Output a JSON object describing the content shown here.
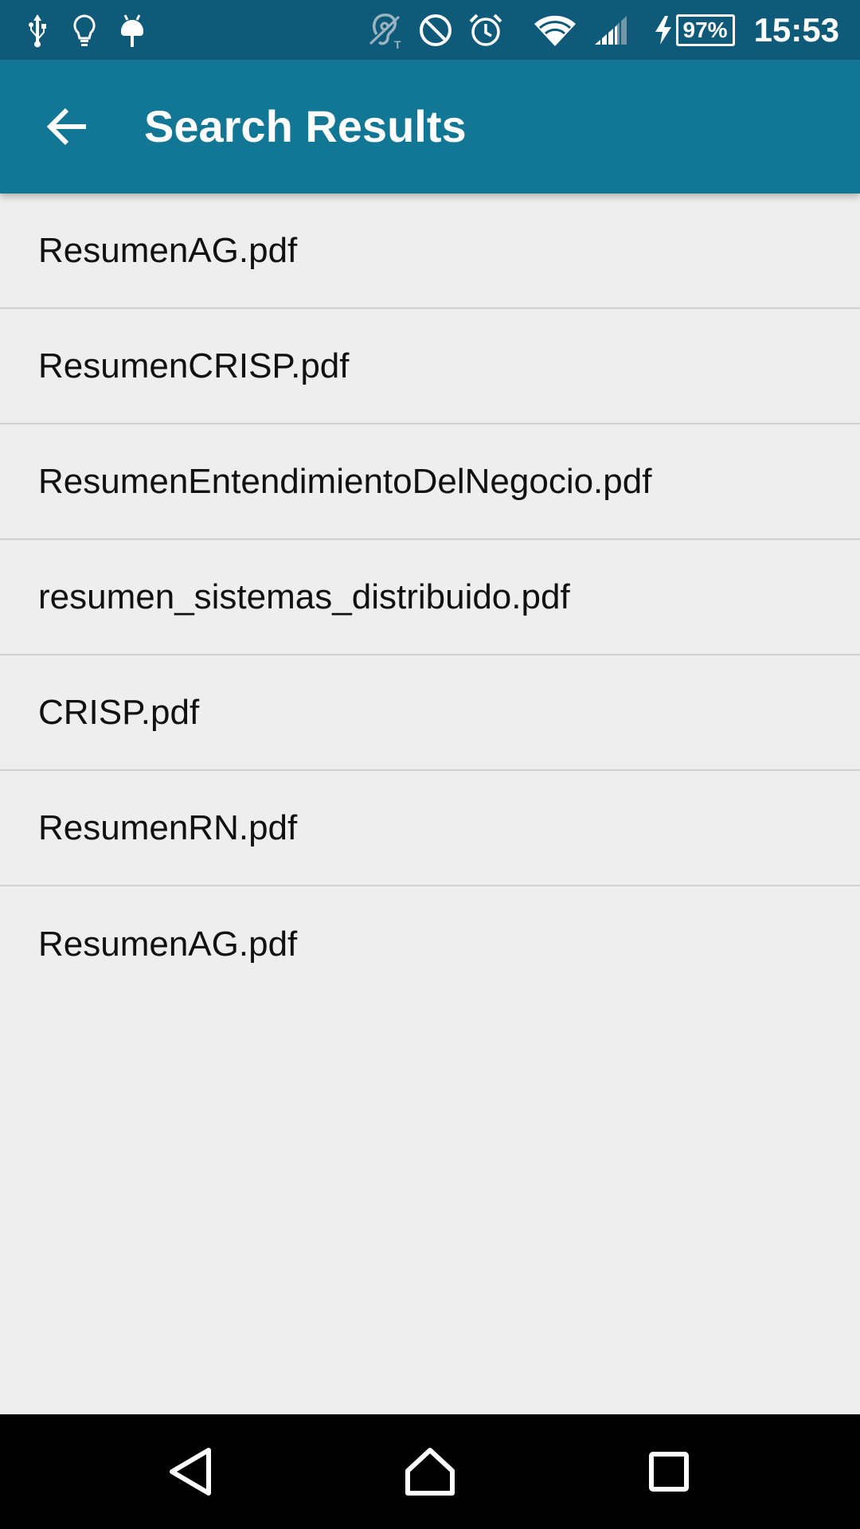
{
  "status_bar": {
    "left_icons": [
      "usb-icon",
      "lightbulb-icon",
      "android-debug-icon"
    ],
    "right_icons": [
      "hearing-aid-icon",
      "do-not-disturb-icon",
      "alarm-icon",
      "wifi-icon",
      "cell-signal-icon",
      "charging-icon"
    ],
    "battery": "97%",
    "time": "15:53"
  },
  "app_bar": {
    "title": "Search Results",
    "back_icon": "arrow-back-icon",
    "background": "#117795"
  },
  "results": [
    {
      "label": "ResumenAG.pdf"
    },
    {
      "label": "ResumenCRISP.pdf"
    },
    {
      "label": "ResumenEntendimientoDelNegocio.pdf"
    },
    {
      "label": "resumen_sistemas_distribuido.pdf"
    },
    {
      "label": "CRISP.pdf"
    },
    {
      "label": "ResumenRN.pdf"
    },
    {
      "label": "ResumenAG.pdf"
    }
  ],
  "nav_bar": {
    "buttons": [
      "back-triangle-icon",
      "home-icon",
      "recents-icon"
    ]
  },
  "colors": {
    "status_bar": "#0f5a78",
    "app_bar": "#117795",
    "background": "#eeeeee",
    "divider": "#d0d0d0"
  }
}
